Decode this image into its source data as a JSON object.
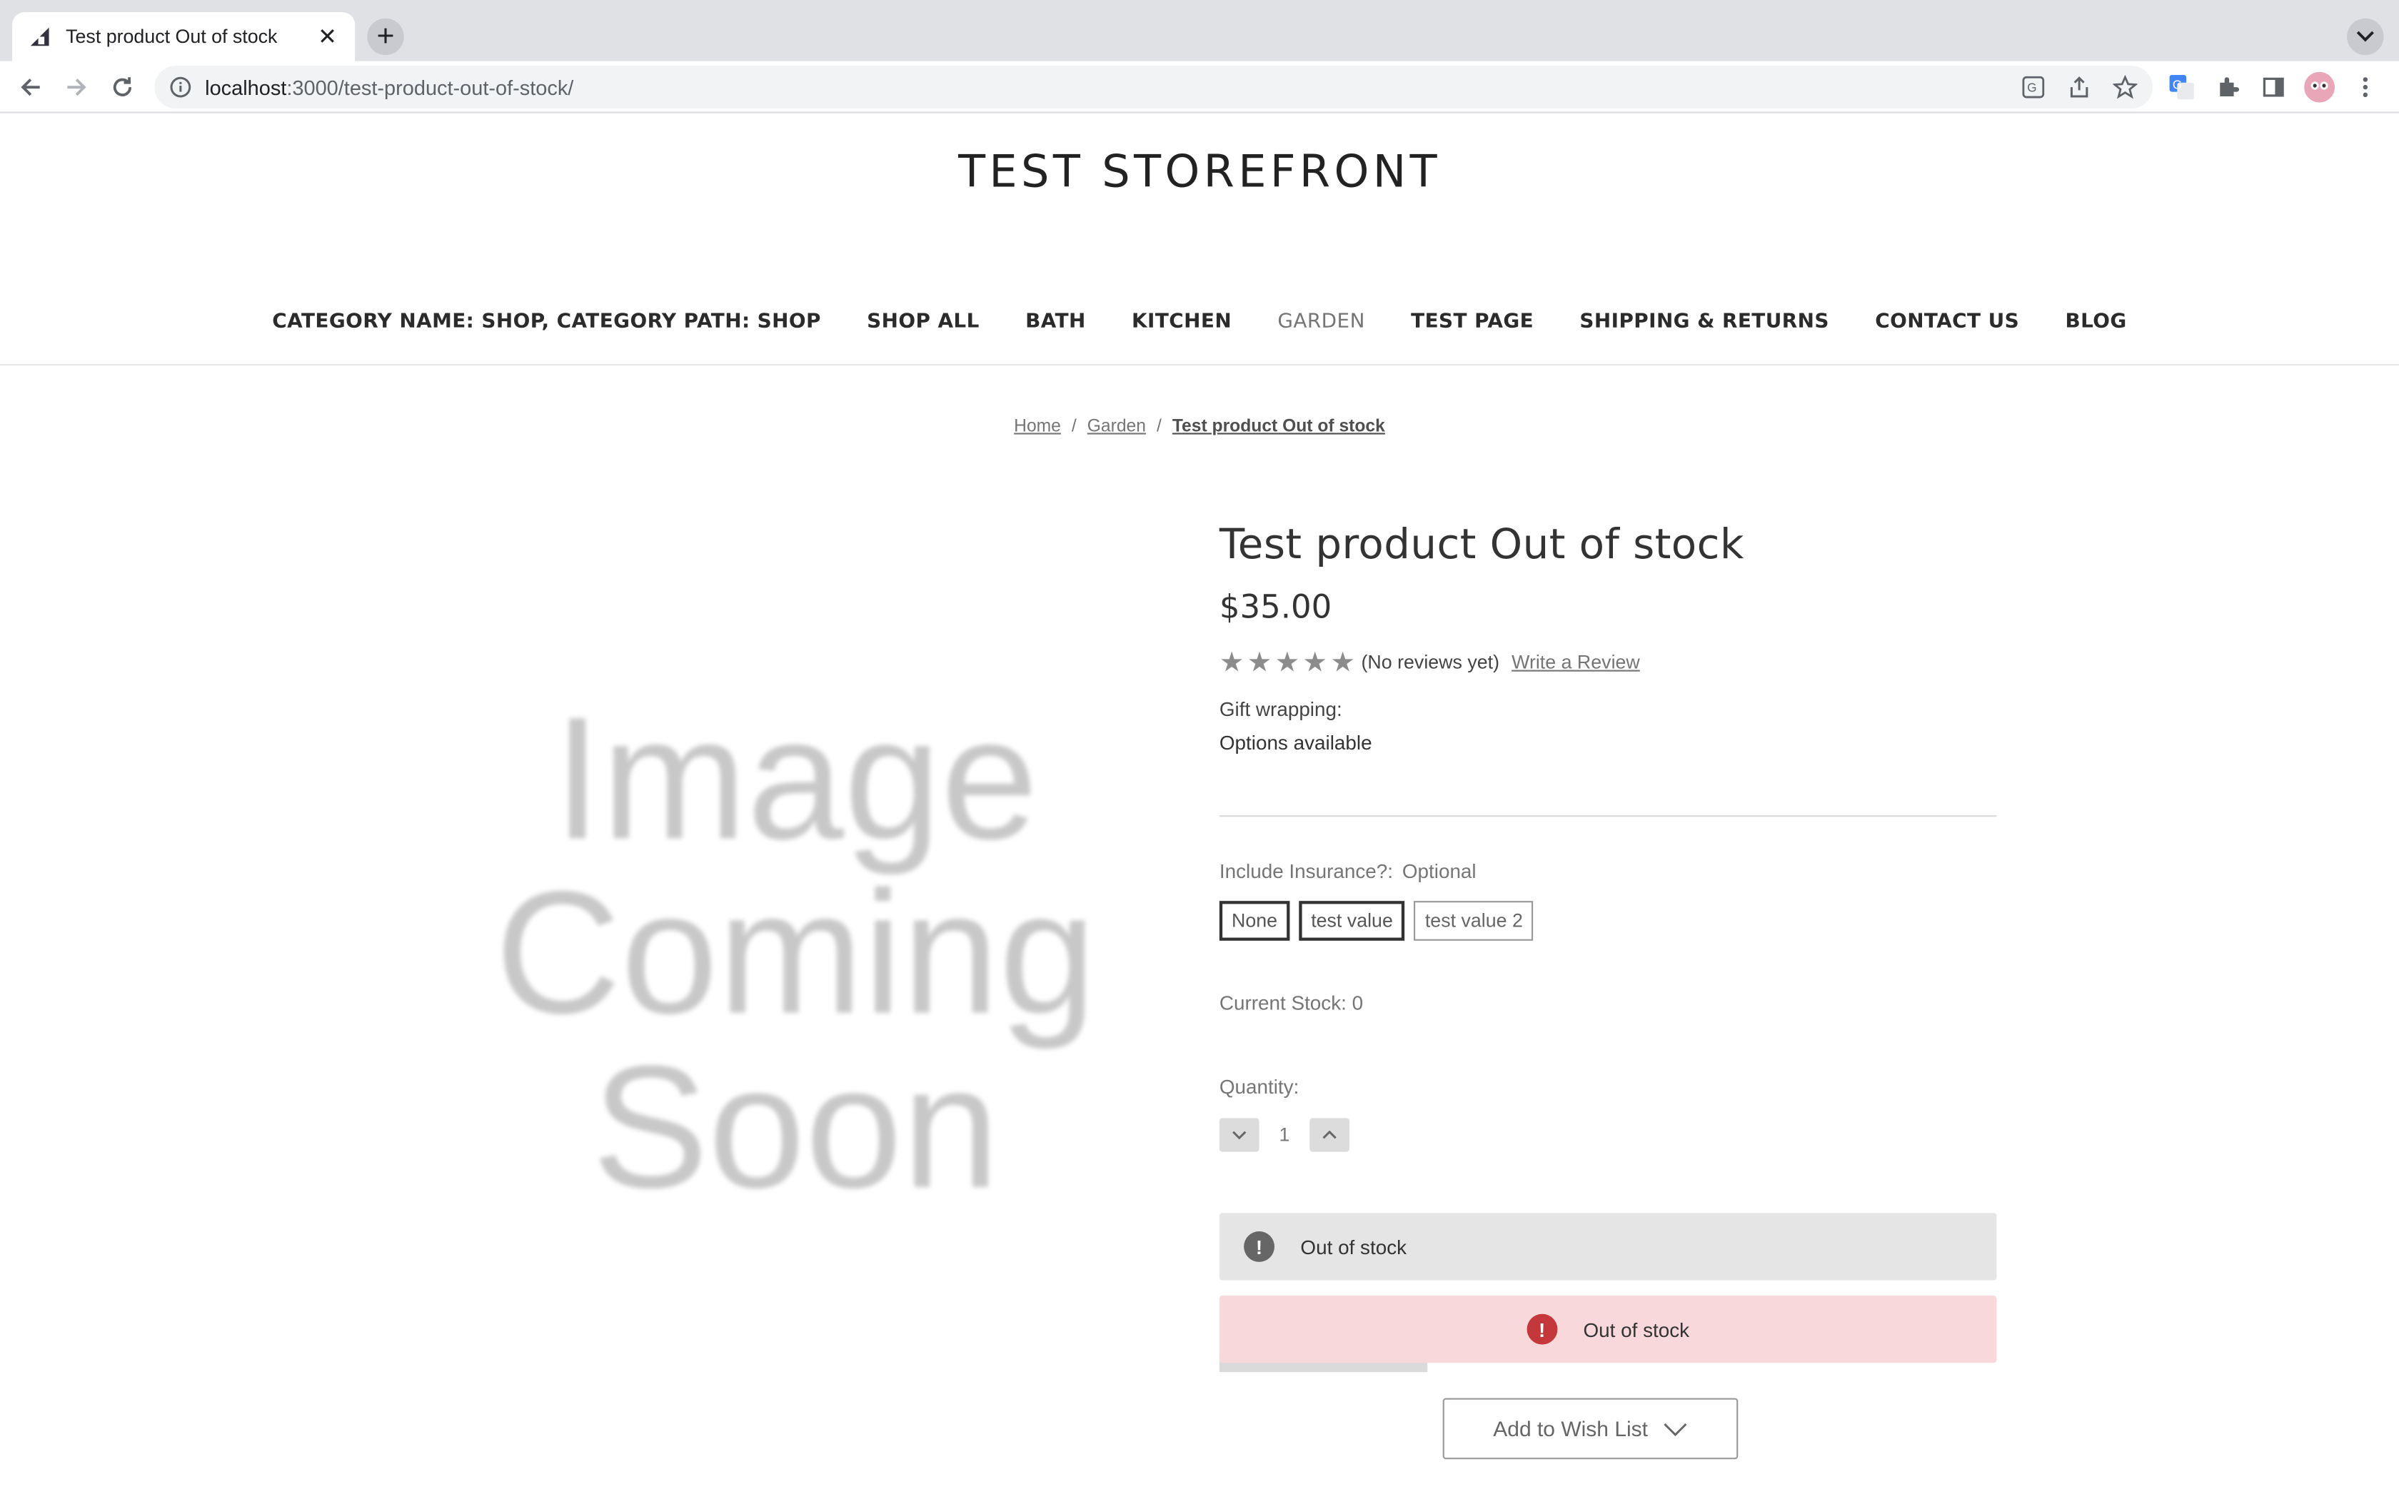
{
  "browser": {
    "tab_title": "Test product Out of stock",
    "url_host": "localhost",
    "url_rest": ":3000/test-product-out-of-stock/",
    "icons": [
      "back-icon",
      "forward-icon",
      "reload-icon",
      "info-icon",
      "translate-icon",
      "share-icon",
      "bookmark-star-icon",
      "google-translate-icon",
      "extensions-icon",
      "side-panel-icon",
      "profile-avatar",
      "menu-icon"
    ]
  },
  "store": {
    "title": "TEST STOREFRONT"
  },
  "nav": {
    "items": [
      "CATEGORY NAME: SHOP, CATEGORY PATH: SHOP",
      "SHOP ALL",
      "BATH",
      "KITCHEN",
      "GARDEN",
      "TEST PAGE",
      "SHIPPING & RETURNS",
      "CONTACT US",
      "BLOG"
    ],
    "active": "GARDEN"
  },
  "breadcrumbs": {
    "home": "Home",
    "category": "Garden",
    "current": "Test product Out of stock",
    "separator": "/"
  },
  "image_placeholder": {
    "line1": "Image",
    "line2": "Coming",
    "line3": "Soon"
  },
  "product": {
    "title": "Test product Out of stock",
    "price": "$35.00",
    "rating_stars": 5,
    "rating_value": 0,
    "reviews_text": "(No reviews yet)",
    "write_review": "Write a Review",
    "gift_label": "Gift wrapping:",
    "gift_value": "Options available",
    "insurance_label": "Include Insurance?:",
    "insurance_optional": "Optional",
    "insurance_options": [
      "None",
      "test value",
      "test value 2"
    ],
    "stock_text": "Current Stock: 0",
    "quantity_label": "Quantity:",
    "quantity_value": "1",
    "alert_grey": "Out of stock",
    "alert_pink": "Out of stock",
    "alert_icon_glyph": "!",
    "wishlist_label": "Add to Wish List"
  },
  "colors": {
    "alert_error": "#c4373b",
    "alert_error_bg": "#f8d8da",
    "alert_info_bg": "#e5e5e5"
  }
}
